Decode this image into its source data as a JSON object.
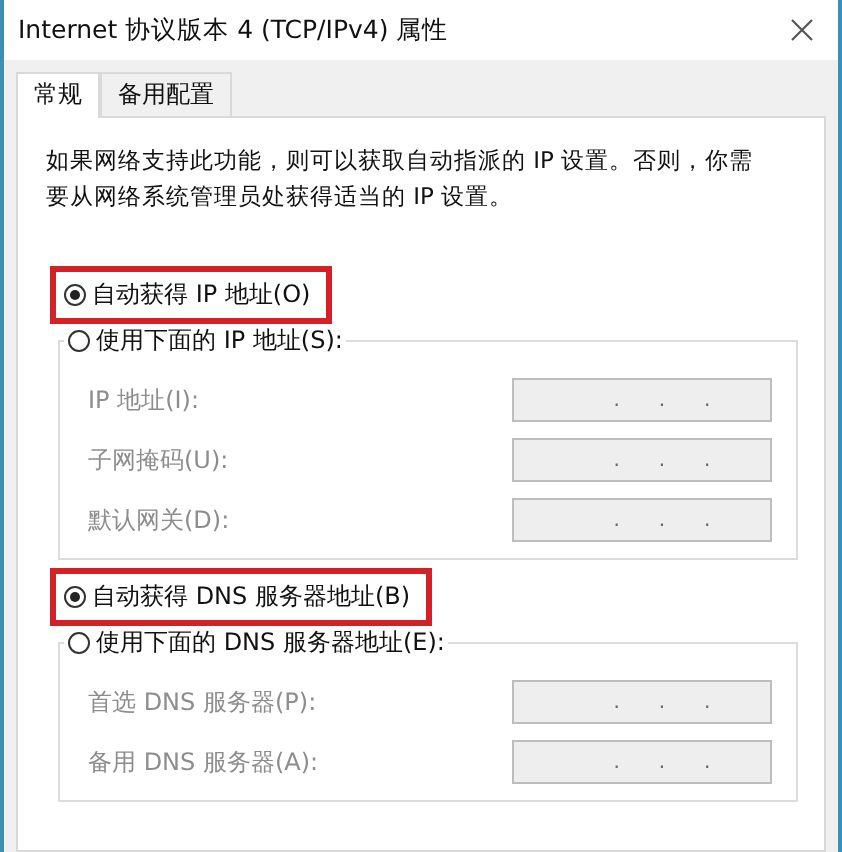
{
  "window": {
    "title": "Internet 协议版本 4 (TCP/IPv4) 属性"
  },
  "tabs": [
    {
      "label": "常规",
      "selected": true
    },
    {
      "label": "备用配置",
      "selected": false
    }
  ],
  "description": "如果网络支持此功能，则可以获取自动指派的 IP 设置。否则，你需要从网络系统管理员处获得适当的 IP 设置。",
  "sections": [
    {
      "options": [
        {
          "label": "自动获得 IP 地址(O)",
          "selected": true,
          "highlighted": true
        },
        {
          "label": "使用下面的 IP 地址(S):",
          "selected": false,
          "highlighted": false
        }
      ],
      "fields": [
        {
          "label": "IP 地址(I):",
          "disabled": true,
          "dots": [
            ".",
            ".",
            "."
          ]
        },
        {
          "label": "子网掩码(U):",
          "disabled": true,
          "dots": [
            ".",
            ".",
            "."
          ]
        },
        {
          "label": "默认网关(D):",
          "disabled": true,
          "dots": [
            ".",
            ".",
            "."
          ]
        }
      ]
    },
    {
      "options": [
        {
          "label": "自动获得 DNS 服务器地址(B)",
          "selected": true,
          "highlighted": true
        },
        {
          "label": "使用下面的 DNS 服务器地址(E):",
          "selected": false,
          "highlighted": false
        }
      ],
      "fields": [
        {
          "label": "首选 DNS 服务器(P):",
          "disabled": true,
          "dots": [
            ".",
            ".",
            "."
          ]
        },
        {
          "label": "备用 DNS 服务器(A):",
          "disabled": true,
          "dots": [
            ".",
            ".",
            "."
          ]
        }
      ]
    }
  ]
}
